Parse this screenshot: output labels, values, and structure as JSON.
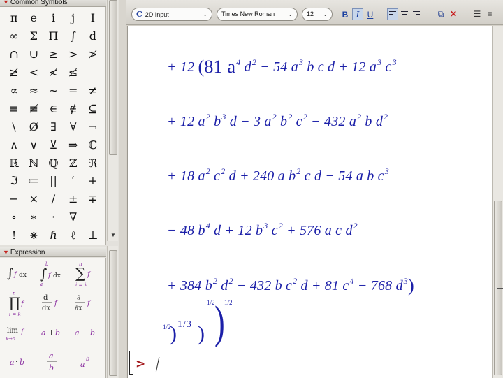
{
  "palettes": {
    "symbols_title": "Common Symbols",
    "symbols": [
      "π",
      "e",
      "i",
      "j",
      "I",
      "∞",
      "Σ",
      "Π",
      "∫",
      "d",
      "∩",
      "∪",
      "≥",
      ">",
      "≯",
      "≱",
      "<",
      "≮",
      "≰",
      "",
      "∝",
      "≈",
      "∼",
      "=",
      "≠",
      "≡",
      "≢",
      "∈",
      "∉",
      "⊆",
      "\\",
      "Ø",
      "∃",
      "∀",
      "¬",
      "∧",
      "∨",
      "⊻",
      "⇒",
      "ℂ",
      "ℝ",
      "ℕ",
      "ℚ",
      "ℤ",
      "ℜ",
      "ℑ",
      "≔",
      "||",
      "′",
      "+",
      "−",
      "×",
      "/",
      "±",
      "∓",
      "∘",
      "∗",
      "·",
      "∇",
      "",
      "!",
      "⋇",
      "ℏ",
      "ℓ",
      "⊥"
    ],
    "expression_title": "Expression"
  },
  "toolbar": {
    "mode": "2D Input",
    "font": "Times New Roman",
    "size": "12",
    "bold": "B",
    "italic": "I",
    "underline": "U"
  },
  "document": {
    "lines": [
      [
        "+ 12 ",
        "(81 a",
        "4",
        " d",
        "2",
        " − 54 a",
        "3",
        " b c d + 12 a",
        "3",
        " c",
        "3"
      ],
      [
        "+ 12 a",
        "2",
        " b",
        "3",
        " d − 3 a",
        "2",
        " b",
        "2",
        " c",
        "2",
        " − 432 a",
        "2",
        " b d",
        "2"
      ],
      [
        "+ 18 a",
        "2",
        " c",
        "2",
        " d + 240 a b",
        "2",
        " c d − 54 a b c",
        "3"
      ],
      [
        "− 48 b",
        "4",
        " d + 12 b",
        "3",
        " c",
        "2",
        " + 576 a c d",
        "2"
      ],
      [
        "+ 384 b",
        "2",
        " d",
        "2",
        " − 432 b c",
        "2",
        " d + 81 c",
        "4",
        " − 768 d",
        "3",
        ")"
      ]
    ],
    "exp_half_1": "1/2",
    "exp_third": "1/3",
    "exp_half_2": "1/2",
    "exp_half_3": "1/2",
    "prompt": ">"
  }
}
